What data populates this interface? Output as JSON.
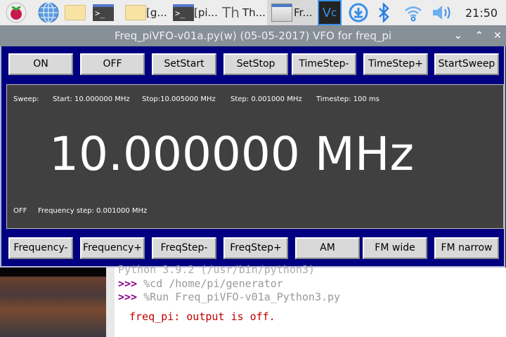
{
  "taskbar": {
    "items": [
      {
        "icon": "raspberry-menu-icon",
        "label": ""
      },
      {
        "icon": "browser-globe-icon",
        "label": ""
      },
      {
        "icon": "file-manager-icon",
        "label": ""
      },
      {
        "icon": "terminal-icon",
        "label": ""
      },
      {
        "icon": "folder-icon",
        "label": "[g..."
      },
      {
        "icon": "terminal-icon",
        "label": "[pi..."
      },
      {
        "icon": "thonny-icon",
        "label": "Th..."
      },
      {
        "icon": "window-icon",
        "label": "Fr..."
      }
    ],
    "tray": [
      "vnc-icon",
      "download-icon",
      "bluetooth-icon",
      "wifi-icon",
      "volume-icon"
    ],
    "clock": "21:50"
  },
  "window": {
    "title": "Freq_piVFO-v01a.py(w) (05-05-2017) VFO for freq_pi",
    "top_buttons": [
      "ON",
      "OFF",
      "SetStart",
      "SetStop",
      "TimeStep-",
      "TimeStep+",
      "StartSweep"
    ],
    "bottom_buttons": [
      "Frequency-",
      "Frequency+",
      "FreqStep-",
      "FreqStep+",
      "AM",
      "FM wide",
      "FM narrow"
    ],
    "display": {
      "sweep_label": "Sweep:",
      "start": "Start: 10.000000 MHz",
      "stop": "Stop:10.005000 MHz",
      "step": "Step: 0.001000 MHz",
      "timestep": "Timestep: 100 ms",
      "frequency": "10.000000 MHz",
      "output_state": "OFF",
      "freq_step": "Frequency step: 0.001000 MHz"
    },
    "colors": {
      "frame": "#000080",
      "panel": "#404040"
    }
  },
  "shell": {
    "line0": "Python 3.9.2 (/usr/bin/python3)",
    "prompt": ">>>",
    "cmd1": "%cd /home/pi/generator",
    "cmd2": "%Run Freq_piVFO-v01a_Python3.py",
    "output": "freq_pi: output is off."
  }
}
